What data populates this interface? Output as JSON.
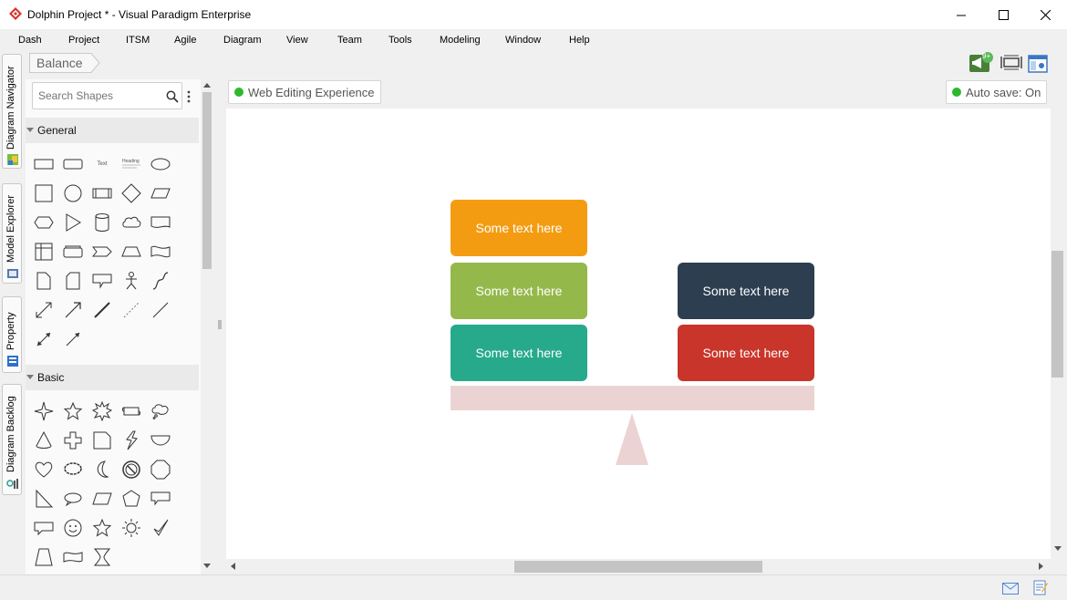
{
  "window": {
    "title": "Dolphin Project * - Visual Paradigm Enterprise",
    "minimize_icon": "minimize-icon",
    "maximize_icon": "maximize-icon",
    "close_icon": "close-icon"
  },
  "menu": [
    "Dash",
    "Project",
    "ITSM",
    "Agile",
    "Diagram",
    "View",
    "Team",
    "Tools",
    "Modeling",
    "Window",
    "Help"
  ],
  "left_tabs": [
    "Diagram Navigator",
    "Model Explorer",
    "Property",
    "Diagram Backlog"
  ],
  "breadcrumb": {
    "label": "Balance"
  },
  "toolbar": {
    "notification_badge": "9+"
  },
  "palette": {
    "search_placeholder": "Search Shapes",
    "sections": [
      "General",
      "Basic"
    ],
    "general_mini_text": "Text",
    "general_mini_heading": "Heading"
  },
  "canvas": {
    "web_editing_label": "Web Editing Experience",
    "autosave_label": "Auto save: On",
    "status_color": "#2eb82e"
  },
  "diagram": {
    "boxes": [
      {
        "text": "Some text here",
        "color": "#f39c12"
      },
      {
        "text": "Some text here",
        "color": "#95b84b"
      },
      {
        "text": "Some text here",
        "color": "#27a98c"
      },
      {
        "text": "Some text here",
        "color": "#2c3e50"
      },
      {
        "text": "Some text here",
        "color": "#c9352a"
      }
    ],
    "beam_color": "#ecd3d3",
    "fulcrum_color": "#ecd3d3"
  }
}
